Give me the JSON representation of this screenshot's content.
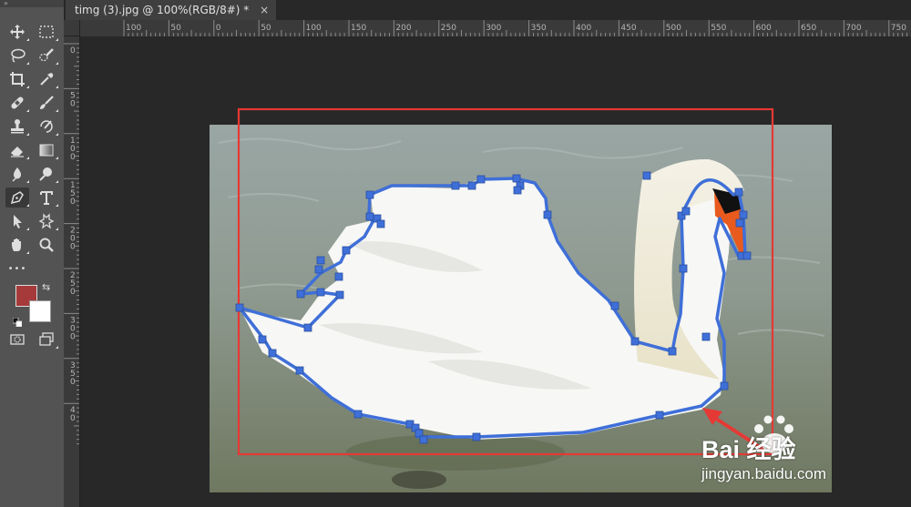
{
  "document": {
    "tab_title": "timg (3).jpg @ 100%(RGB/8#) *",
    "close_glyph": "×"
  },
  "toolbar": {
    "grip": "»",
    "more_glyph": "•••",
    "tools": [
      {
        "name": "move-tool-icon"
      },
      {
        "name": "marquee-tool-icon"
      },
      {
        "name": "lasso-tool-icon"
      },
      {
        "name": "quick-selection-tool-icon"
      },
      {
        "name": "crop-tool-icon"
      },
      {
        "name": "eyedropper-tool-icon"
      },
      {
        "name": "healing-brush-tool-icon"
      },
      {
        "name": "brush-tool-icon"
      },
      {
        "name": "clone-stamp-tool-icon"
      },
      {
        "name": "history-brush-tool-icon"
      },
      {
        "name": "eraser-tool-icon"
      },
      {
        "name": "gradient-tool-icon"
      },
      {
        "name": "blur-tool-icon"
      },
      {
        "name": "dodge-tool-icon"
      },
      {
        "name": "pen-tool-icon",
        "active": true
      },
      {
        "name": "type-tool-icon"
      },
      {
        "name": "path-selection-tool-icon"
      },
      {
        "name": "custom-shape-tool-icon"
      },
      {
        "name": "hand-tool-icon"
      },
      {
        "name": "zoom-tool-icon"
      }
    ],
    "foreground_color": "#a63a3a",
    "background_color": "#ffffff"
  },
  "rulers": {
    "horizontal_labels": [
      "100",
      "50",
      "0",
      "50",
      "100",
      "150",
      "200",
      "250",
      "300",
      "350",
      "400",
      "450",
      "500",
      "550",
      "600",
      "650",
      "700",
      "750"
    ],
    "vertical_labels": [
      "0",
      "5 0",
      "1 0 0",
      "1 5 0",
      "2 0 0",
      "2 5 0",
      "3 0 0",
      "3 5 0",
      "4 0"
    ]
  },
  "annotation": {
    "rect_color": "#e53935",
    "arrow_color": "#e53935",
    "path_color": "#3f6fd8"
  },
  "watermark": {
    "logo_text": "Bai   经验",
    "url_text": "jingyan.baidu.com"
  }
}
